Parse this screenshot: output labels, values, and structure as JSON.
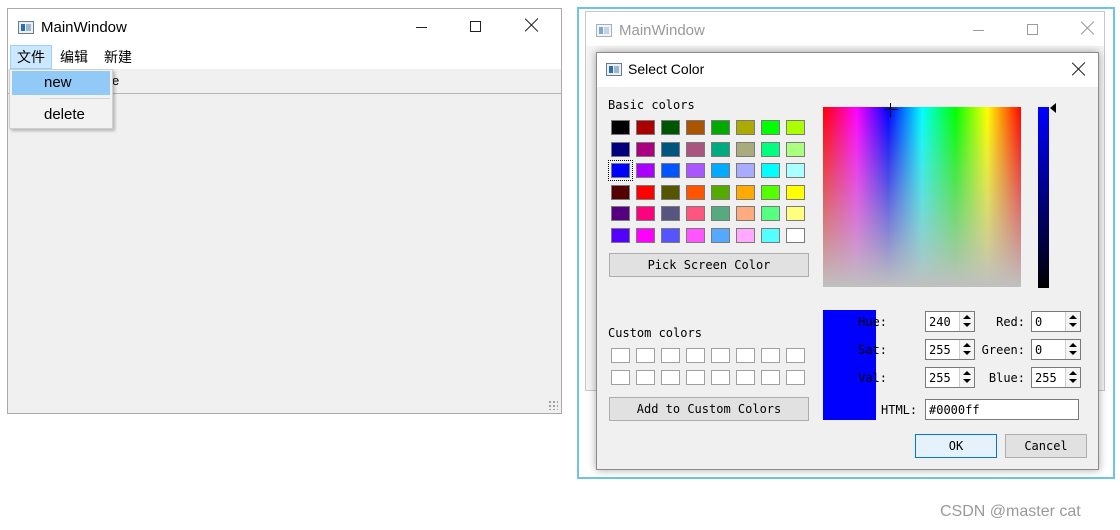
{
  "left_window": {
    "title": "MainWindow",
    "menu": [
      "文件",
      "编辑",
      "新建"
    ],
    "toolbar_label": "e",
    "dropdown": [
      "new",
      "delete"
    ]
  },
  "right_window": {
    "title": "MainWindow"
  },
  "dialog": {
    "title": "Select Color",
    "basic_colors_label": "Basic colors",
    "basic_colors": [
      [
        "#000000",
        "#aa0000",
        "#005500",
        "#aa5500",
        "#00aa00",
        "#aaaa00",
        "#00ff00",
        "#aaff00"
      ],
      [
        "#00007f",
        "#aa007f",
        "#00557f",
        "#aa557f",
        "#00aa7f",
        "#aaaa7f",
        "#00ff7f",
        "#aaff7f"
      ],
      [
        "#0000ff",
        "#aa00ff",
        "#0055ff",
        "#aa55ff",
        "#00aaff",
        "#aaaaff",
        "#00ffff",
        "#aaffff"
      ],
      [
        "#550000",
        "#ff0000",
        "#555500",
        "#ff5500",
        "#55aa00",
        "#ffaa00",
        "#55ff00",
        "#ffff00"
      ],
      [
        "#55007f",
        "#ff007f",
        "#55557f",
        "#ff557f",
        "#55aa7f",
        "#ffaa7f",
        "#55ff7f",
        "#ffff7f"
      ],
      [
        "#5500ff",
        "#ff00ff",
        "#5555ff",
        "#ff55ff",
        "#55aaff",
        "#ffaaff",
        "#55ffff",
        "#ffffff"
      ]
    ],
    "selected_basic": "#0000ff",
    "pick_screen_label": "Pick Screen Color",
    "custom_colors_label": "Custom colors",
    "add_custom_label": "Add to Custom Colors",
    "fields": {
      "hue_label": "Hue:",
      "hue": "240",
      "sat_label": "Sat:",
      "sat": "255",
      "val_label": "Val:",
      "val": "255",
      "red_label": "Red:",
      "red": "0",
      "green_label": "Green:",
      "green": "0",
      "blue_label": "Blue:",
      "blue": "255"
    },
    "html_label": "HTML:",
    "html_value": "#0000ff",
    "ok_label": "OK",
    "cancel_label": "Cancel",
    "current_color": "#0000ff"
  },
  "watermark": "CSDN @master cat"
}
